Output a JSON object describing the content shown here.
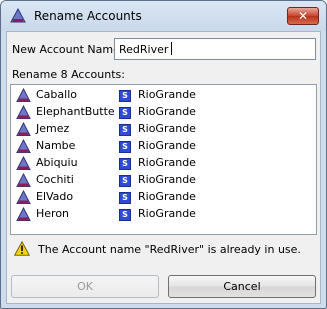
{
  "window": {
    "title": "Rename Accounts",
    "close_label": "✕"
  },
  "form": {
    "new_name_label": "New Account Name:",
    "new_name_value": "RedRiver",
    "rename_count_label": "Rename 8 Accounts:"
  },
  "accounts": [
    {
      "name": "Caballo",
      "badge": "S",
      "object": "RioGrande"
    },
    {
      "name": "ElephantButte",
      "badge": "S",
      "object": "RioGrande"
    },
    {
      "name": "Jemez",
      "badge": "S",
      "object": "RioGrande"
    },
    {
      "name": "Nambe",
      "badge": "S",
      "object": "RioGrande"
    },
    {
      "name": "Abiquiu",
      "badge": "S",
      "object": "RioGrande"
    },
    {
      "name": "Cochiti",
      "badge": "S",
      "object": "RioGrande"
    },
    {
      "name": "ElVado",
      "badge": "S",
      "object": "RioGrande"
    },
    {
      "name": "Heron",
      "badge": "S",
      "object": "RioGrande"
    }
  ],
  "warning": {
    "icon": "warning-icon",
    "text": "The Account name \"RedRiver\" is already in use."
  },
  "buttons": {
    "ok_label": "OK",
    "ok_enabled": false,
    "cancel_label": "Cancel"
  },
  "icons": {
    "account_icon": "triangle-account-icon",
    "badge_color": "#2f4bd6",
    "account_icon_color": "#6e76c8"
  }
}
